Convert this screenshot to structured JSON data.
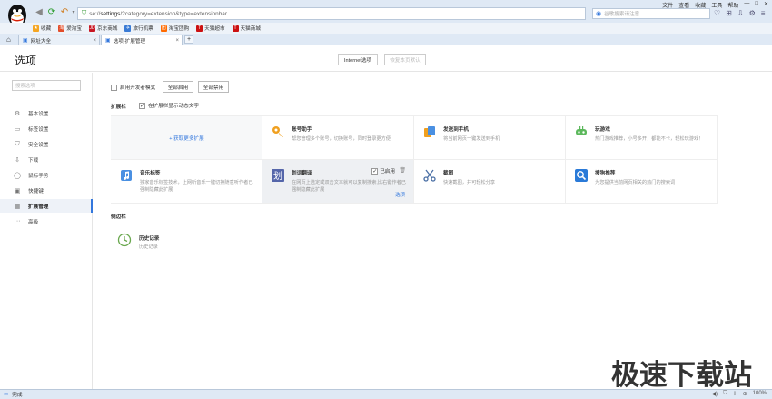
{
  "browser": {
    "menu": [
      "文件",
      "查看",
      "收藏",
      "工具",
      "帮助"
    ],
    "url_prefix": "se://",
    "url_main": "settings",
    "url_rest": "/?category=extension&type=extensionbar",
    "search_placeholder": "谷歌搜索请注意",
    "favorites": [
      {
        "label": "收藏",
        "color": "#f5a623",
        "glyph": "★"
      },
      {
        "label": "爱淘宝",
        "color": "#e34d2a",
        "glyph": "淘"
      },
      {
        "label": "京东商城",
        "color": "#c81623",
        "glyph": "JD"
      },
      {
        "label": "旅行机票",
        "color": "#3a7bd5",
        "glyph": "✈"
      },
      {
        "label": "淘宝团购",
        "color": "#ff6a00",
        "glyph": "团"
      },
      {
        "label": "天猫超市",
        "color": "#cc1111",
        "glyph": "T"
      },
      {
        "label": "天猫商城",
        "color": "#cc1111",
        "glyph": "T"
      }
    ],
    "tabs": [
      {
        "label": "网址大全"
      },
      {
        "label": "选项-扩展管理"
      }
    ],
    "status_text": "完成",
    "zoom": "100%"
  },
  "header": {
    "title": "选项",
    "internet_options": "Internet选项",
    "restore_default": "恢复本页默认"
  },
  "sidebar": {
    "search_placeholder": "搜索选项",
    "items": [
      {
        "label": "基本设置",
        "icon": "gear-icon",
        "glyph": "⚙"
      },
      {
        "label": "标签设置",
        "icon": "tag-icon",
        "glyph": "▭"
      },
      {
        "label": "安全设置",
        "icon": "shield-icon",
        "glyph": "⛉"
      },
      {
        "label": "下载",
        "icon": "download-icon",
        "glyph": "⇩"
      },
      {
        "label": "鼠标手势",
        "icon": "mouse-icon",
        "glyph": "◯"
      },
      {
        "label": "快捷键",
        "icon": "keyboard-icon",
        "glyph": "▣"
      },
      {
        "label": "扩展管理",
        "icon": "extension-icon",
        "glyph": "▦"
      },
      {
        "label": "高级",
        "icon": "more-icon",
        "glyph": "···"
      }
    ]
  },
  "main": {
    "dev_mode": "启用开发者模式",
    "enable_all": "全部启用",
    "disable_all": "全部禁用",
    "extension_bar_label": "扩展栏",
    "show_text": "在扩展栏显示动态文字",
    "get_more": "+ 获取更多扩展",
    "extensions": [
      {
        "name": "账号助手",
        "desc": "帮您管理多个账号，切换账号，同时登录更方便",
        "icon": "key-icon"
      },
      {
        "name": "发送到手机",
        "desc": "将当前网页一键发送到手机",
        "icon": "phone-icon"
      },
      {
        "name": "玩游戏",
        "desc": "热门游戏推荐，小号多开，都能不卡，轻松玩游戏！",
        "icon": "gamepad-icon"
      },
      {
        "name": "音乐标签",
        "desc": "独家音乐标签技术，上网听音乐一键切换随意听作者已强制隐藏此扩展",
        "icon": "music-icon"
      },
      {
        "name": "划词翻译",
        "desc": "在网页上选定或双击文本就可以复制搜索,比右键作者已强制隐藏此扩展",
        "icon": "translate-icon",
        "enabled_label": "已启用",
        "options_label": "选项"
      },
      {
        "name": "截图",
        "desc": "快速截图，并可轻松分享",
        "icon": "scissors-icon"
      },
      {
        "name": "搜狗推荐",
        "desc": "为您提供当前网页相关的热门的搜索词",
        "icon": "search-icon"
      }
    ],
    "sidebar_label": "侧边栏",
    "history_name": "历史记录",
    "history_desc": "历史记录"
  },
  "watermark": "极速下载站"
}
